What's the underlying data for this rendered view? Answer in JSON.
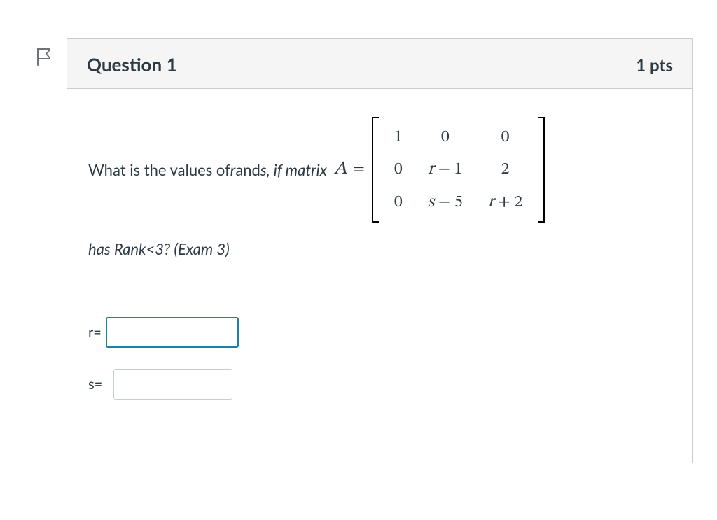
{
  "header": {
    "title": "Question 1",
    "points": "1 pts"
  },
  "question": {
    "prompt_prefix": "What is the values of ",
    "var_r": "r",
    "and": " and ",
    "var_s": "s",
    "if_matrix": ", if matrix ",
    "matrix_name": "A",
    "equals": "=",
    "matrix": {
      "rows": [
        [
          "1",
          "0",
          "0"
        ],
        [
          "0",
          "r − 1",
          "2"
        ],
        [
          "0",
          "s − 5",
          "r + 2"
        ]
      ]
    },
    "subline": "has Rank<3?  (Exam 3)"
  },
  "answers": {
    "r_label": "r=",
    "r_value": "",
    "s_label": "s=",
    "s_value": ""
  },
  "icons": {
    "flag": "flag-outline-icon"
  }
}
